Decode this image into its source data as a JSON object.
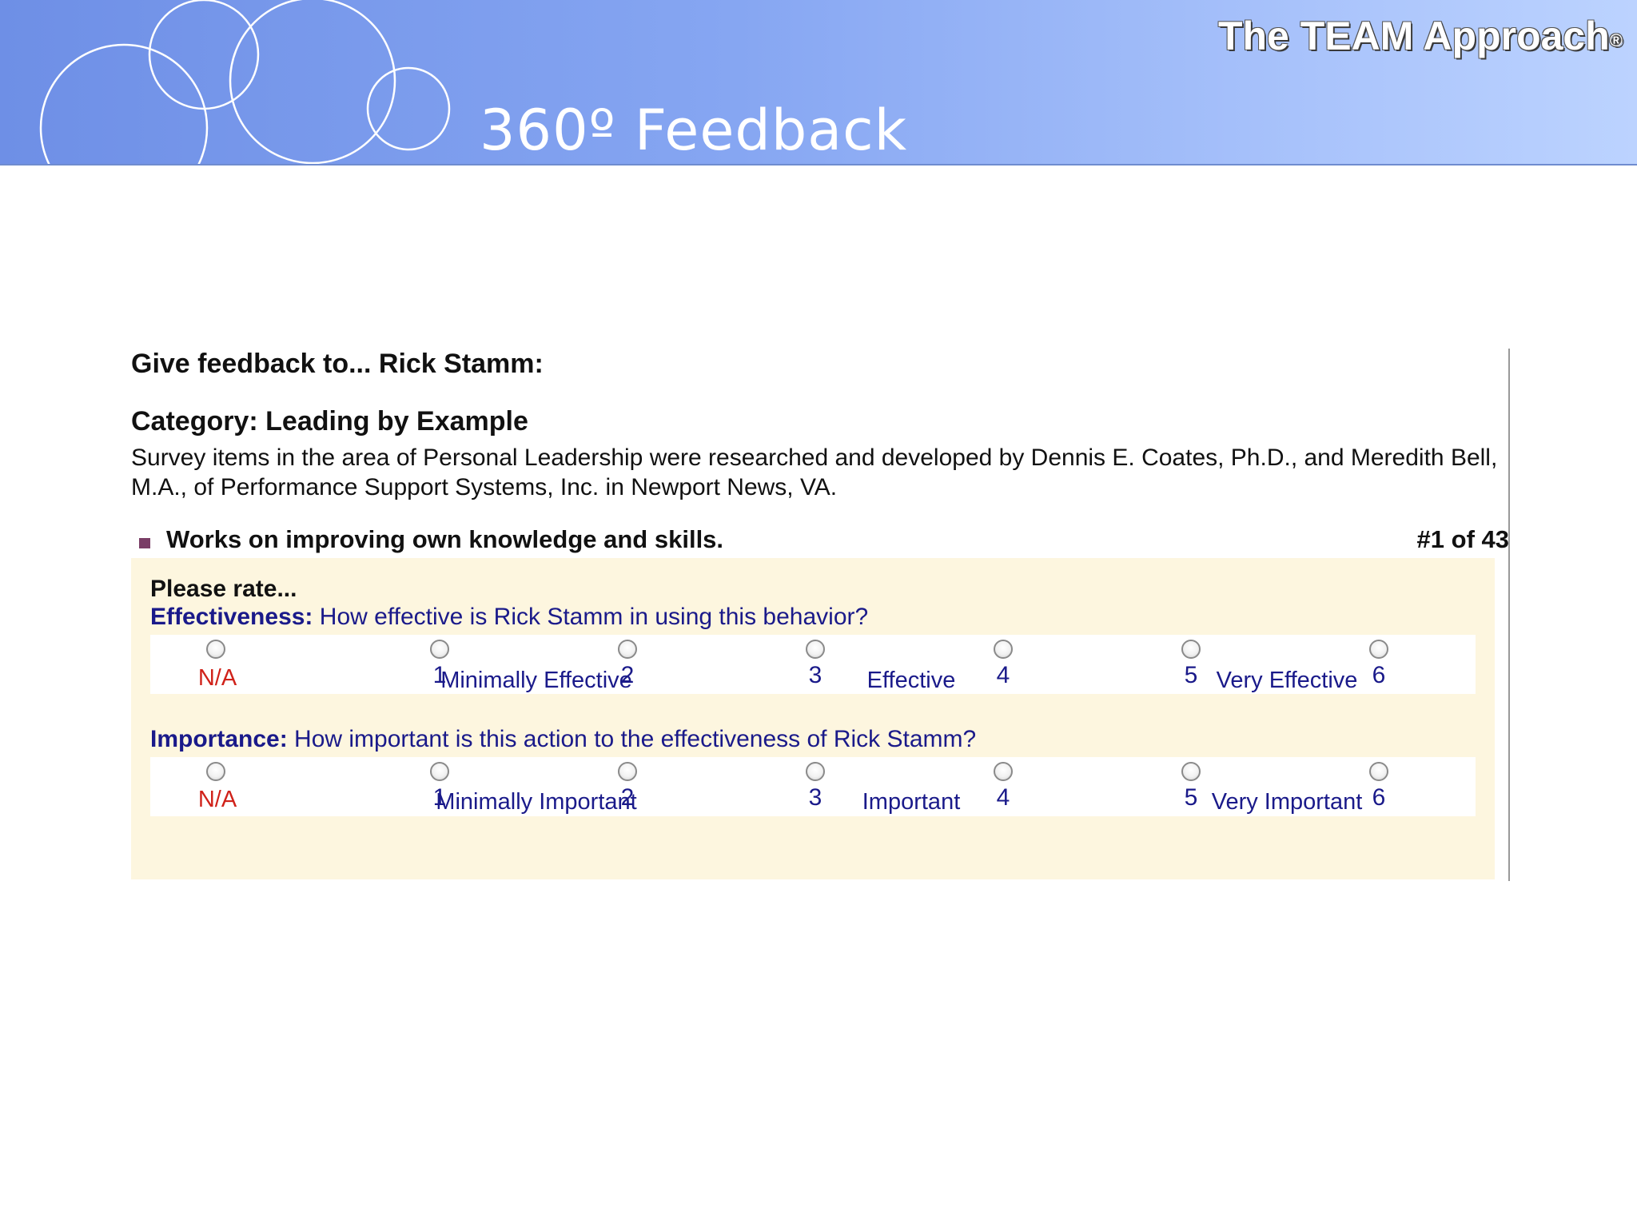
{
  "header": {
    "brand": "The TEAM Approach",
    "brand_mark": "®",
    "slide_title": "360º Feedback"
  },
  "survey": {
    "give_feedback": "Give feedback to... Rick Stamm:",
    "category": "Category: Leading by Example",
    "description": "Survey items in the area of Personal Leadership were researched and developed by Dennis E. Coates, Ph.D., and Meredith Bell, M.A., of Performance Support Systems, Inc. in Newport News, VA.",
    "item": "Works on improving own knowledge and skills.",
    "counter": "#1 of 43",
    "please_rate": "Please rate...",
    "effectiveness": {
      "label": "Effectiveness:",
      "question": "How effective is Rick Stamm in using this behavior?",
      "options": [
        "",
        "1",
        "2",
        "3",
        "4",
        "5",
        "6"
      ],
      "na": "N/A",
      "scale_low": "Minimally Effective",
      "scale_mid": "Effective",
      "scale_high": "Very Effective"
    },
    "importance": {
      "label": "Importance:",
      "question": "How important is this action to the effectiveness of Rick Stamm?",
      "options": [
        "",
        "1",
        "2",
        "3",
        "4",
        "5",
        "6"
      ],
      "na": "N/A",
      "scale_low": "Minimally Important",
      "scale_mid": "Important",
      "scale_high": "Very Important"
    }
  },
  "colors": {
    "banner_start": "#6e8fe6",
    "banner_end": "#bcd3ff",
    "rating_bg": "#fdf6df",
    "question_text": "#1a1a8a",
    "na_text": "#d0221a",
    "bullet": "#7a3d66"
  }
}
